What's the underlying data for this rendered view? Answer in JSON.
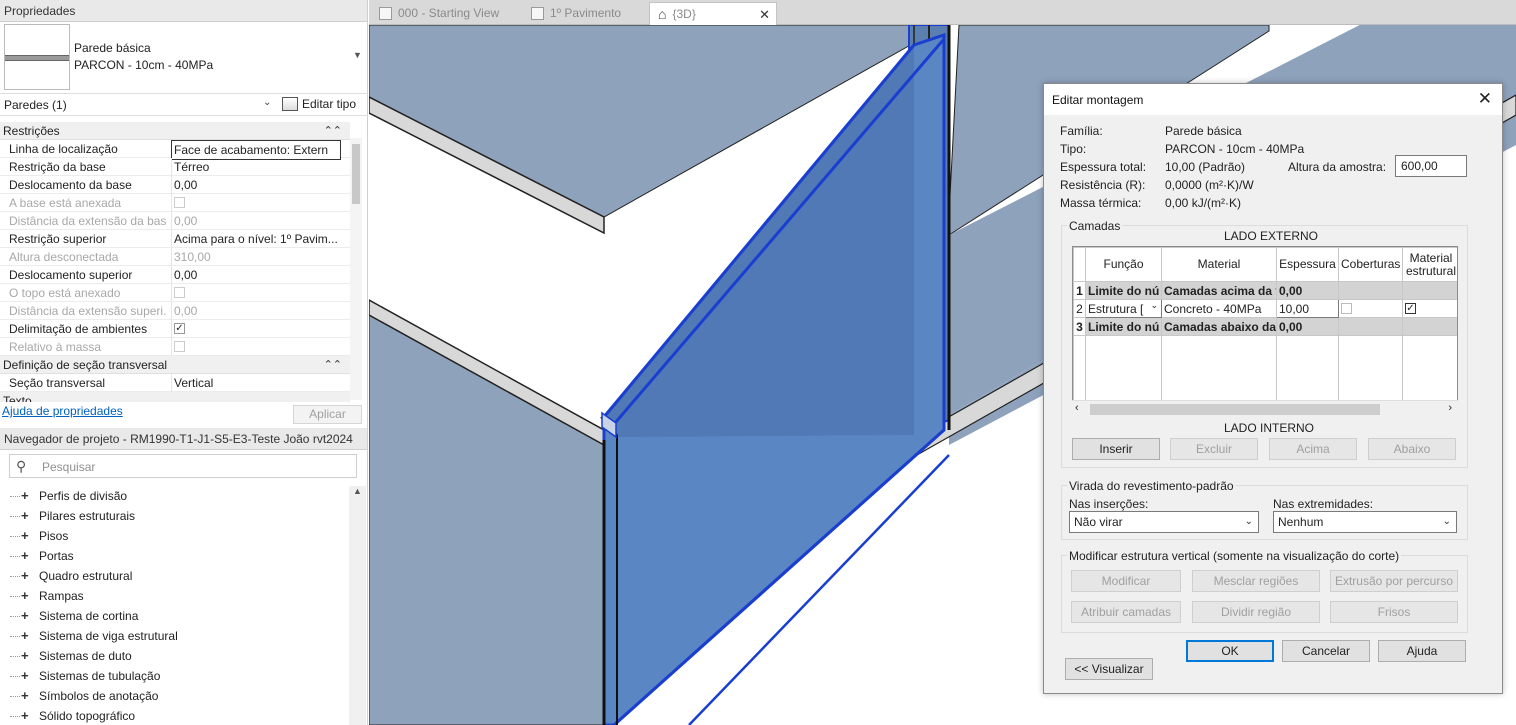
{
  "properties": {
    "title": "Propriedades",
    "type_name_1": "Parede básica",
    "type_name_2": "PARCON - 10cm - 40MPa",
    "instance_filter": "Paredes (1)",
    "edit_type": "Editar tipo",
    "help_link": "Ajuda de propriedades",
    "apply": "Aplicar",
    "sections": [
      {
        "title": "Restrições",
        "rows": [
          {
            "k": "Linha de localização",
            "v": "Face de acabamento: Extern"
          },
          {
            "k": "Restrição da base",
            "v": "Térreo"
          },
          {
            "k": "Deslocamento da base",
            "v": "0,00"
          },
          {
            "k": "A base está anexada",
            "v": ""
          },
          {
            "k": "Distância da extensão da base",
            "v": "0,00"
          },
          {
            "k": "Restrição superior",
            "v": "Acima para o nível: 1º Pavim..."
          },
          {
            "k": "Altura desconectada",
            "v": "310,00"
          },
          {
            "k": "Deslocamento superior",
            "v": "0,00"
          },
          {
            "k": "O topo está anexado",
            "v": ""
          },
          {
            "k": "Distância da extensão superi...",
            "v": "0,00"
          },
          {
            "k": "Delimitação de ambientes",
            "v": "✓"
          },
          {
            "k": "Relativo à massa",
            "v": ""
          }
        ]
      },
      {
        "title": "Definição de seção transversal",
        "rows": [
          {
            "k": "Seção transversal",
            "v": "Vertical"
          }
        ]
      },
      {
        "title": "Texto",
        "rows": []
      }
    ]
  },
  "browser": {
    "title": "Navegador de projeto - RM1990-T1-J1-S5-E3-Teste João rvt2024",
    "search_placeholder": "Pesquisar",
    "items": [
      "Perfis de divisão",
      "Pilares estruturais",
      "Pisos",
      "Portas",
      "Quadro estrutural",
      "Rampas",
      "Sistema de cortina",
      "Sistema de viga estrutural",
      "Sistemas de duto",
      "Sistemas de tubulação",
      "Símbolos de anotação",
      "Sólido topográfico"
    ]
  },
  "tabs": [
    {
      "label": "000 - Starting View"
    },
    {
      "label": "1º Pavimento"
    },
    {
      "label": "{3D}"
    }
  ],
  "dialog": {
    "title": "Editar montagem",
    "family_label": "Família:",
    "family_value": "Parede básica",
    "type_label": "Tipo:",
    "type_value": "PARCON - 10cm - 40MPa",
    "thickness_label": "Espessura total:",
    "thickness_value": "10,00 (Padrão)",
    "sample_height_label": "Altura da amostra:",
    "sample_height_value": "600,00",
    "resistance_label": "Resistência (R):",
    "resistance_value": "0,0000 (m²·K)/W",
    "thermal_label": "Massa térmica:",
    "thermal_value": "0,00 kJ/(m²·K)",
    "layers_group": "Camadas",
    "exterior_side": "LADO EXTERNO",
    "interior_side": "LADO INTERNO",
    "columns": [
      "Função",
      "Material",
      "Espessura",
      "Coberturas",
      "Material estrutural"
    ],
    "layers": [
      {
        "n": "1",
        "func": "Limite do nú",
        "mat": "Camadas acima da vi",
        "thk": "0,00"
      },
      {
        "n": "2",
        "func": "Estrutura [",
        "mat": "Concreto - 40MPa",
        "thk": "10,00"
      },
      {
        "n": "3",
        "func": "Limite do nú",
        "mat": "Camadas abaixo da",
        "thk": "0,00"
      }
    ],
    "buttons_layers": [
      "Inserir",
      "Excluir",
      "Acima",
      "Abaixo"
    ],
    "wrap_group": "Virada do revestimento-padrão",
    "inserts_label": "Nas inserções:",
    "inserts_value": "Não virar",
    "ends_label": "Nas extremidades:",
    "ends_value": "Nenhum",
    "vertical_group": "Modificar estrutura vertical (somente na visualização do corte)",
    "vbuttons": [
      "Modificar",
      "Mesclar regiões",
      "Extrusão por percurso",
      "Atribuir camadas",
      "Dividir região",
      "Frisos"
    ],
    "ok": "OK",
    "cancel": "Cancelar",
    "help": "Ajuda",
    "preview": "<< Visualizar"
  },
  "colors": {
    "wall_blue": "#8ea2bc",
    "selected_blue": "#5b86c4",
    "edge_blue": "#1a3fd0"
  }
}
